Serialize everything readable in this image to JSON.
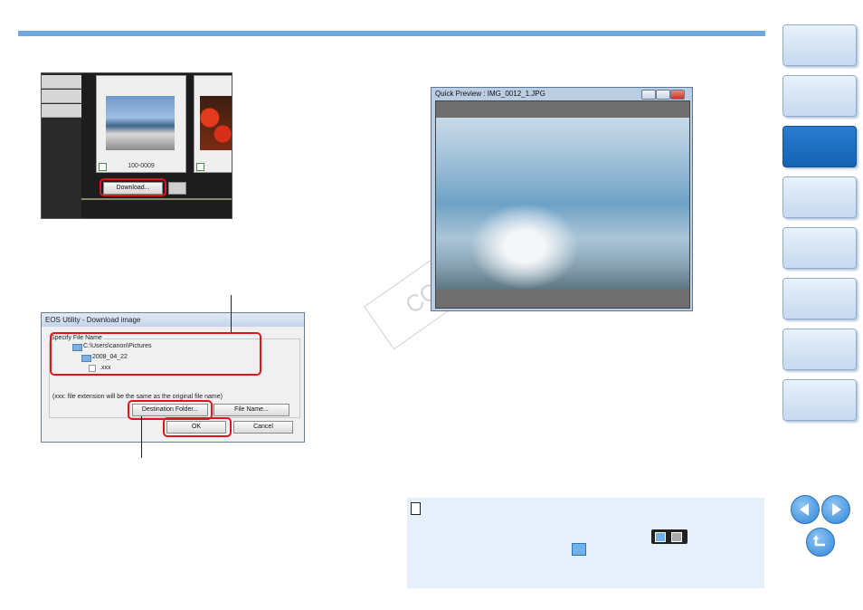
{
  "navigation": {
    "tabs": [
      "",
      "",
      "",
      "",
      "",
      "",
      "",
      ""
    ],
    "active_index": 2
  },
  "screenshot_download": {
    "thumbnail_label": "100-0009",
    "download_button": "Download..."
  },
  "dialog": {
    "title": "EOS Utility - Download image",
    "group_label": "Specify File Name",
    "path_root": "C:\\Users\\canon\\Pictures",
    "path_folder": "2008_04_22",
    "path_file": ".xxx",
    "extension_note": "(xxx: file extension will be the same as the original file name)",
    "destination_button": "Destination Folder...",
    "file_name_button": "File Name...",
    "ok_button": "OK",
    "cancel_button": "Cancel"
  },
  "quick_preview": {
    "title": "Quick Preview : IMG_0012_1.JPG"
  },
  "watermark": "COPY"
}
